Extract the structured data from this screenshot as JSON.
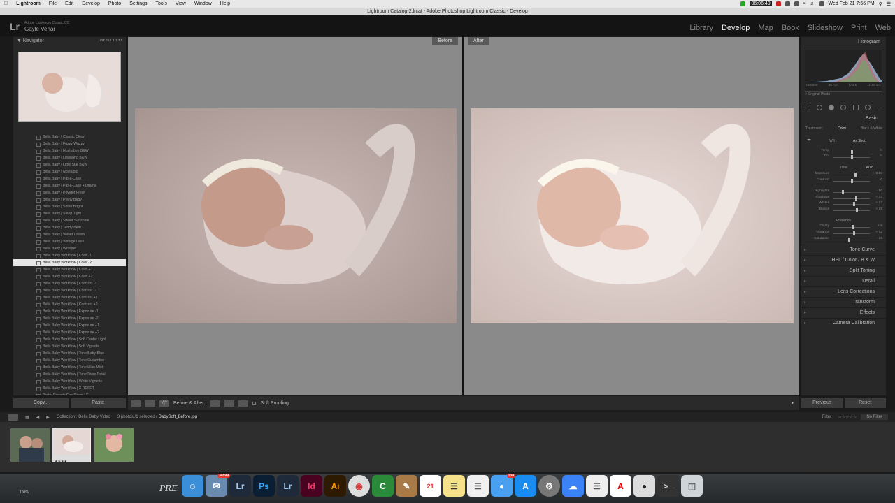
{
  "menubar": {
    "items": [
      "Lightroom",
      "File",
      "Edit",
      "Develop",
      "Photo",
      "Settings",
      "Tools",
      "View",
      "Window",
      "Help"
    ],
    "timer": "06:06:49",
    "datetime": "Wed Feb 21  7:56 PM"
  },
  "window_title": "Lightroom Catalog-2.lrcat - Adobe Photoshop Lightroom Classic - Develop",
  "lr_header": {
    "logo": "Lr",
    "edition": "Adobe Lightroom Classic CC",
    "user": "Gayle Vehar",
    "modules": [
      "Library",
      "Develop",
      "Map",
      "Book",
      "Slideshow",
      "Print",
      "Web"
    ],
    "active_module": "Develop"
  },
  "navigator": {
    "title": "Navigator",
    "zoom_options": "FIT   FILL   1:1   3:1"
  },
  "presets": [
    "Bella Baby | Classic Clean",
    "Bella Baby | Fuzzy Wuzzy",
    "Bella Baby | Hushabye B&W",
    "Bella Baby | Lovewing B&W",
    "Bella Baby | Little Star B&W",
    "Bella Baby | Nostalgic",
    "Bella Baby | Pat-a-Cake",
    "Bella Baby | Pat-a-Cake + Drama",
    "Bella Baby | Powder Fresh",
    "Bella Baby | Pretty Baby",
    "Bella Baby | Shine Bright",
    "Bella Baby | Sleep Tight",
    "Bella Baby | Sweet Sunshine",
    "Bella Baby | Teddy Bear",
    "Bella Baby | Velvet Dream",
    "Bella Baby | Vintage Lace",
    "Bella Baby | Whisper",
    "Bella Baby Workflow | Color -1",
    "Bella Baby Workflow | Color -2",
    "Bella Baby Workflow | Color +1",
    "Bella Baby Workflow | Color +2",
    "Bella Baby Workflow | Contrast -1",
    "Bella Baby Workflow | Contrast -2",
    "Bella Baby Workflow | Contrast +1",
    "Bella Baby Workflow | Contrast +2",
    "Bella Baby Workflow | Exposure -1",
    "Bella Baby Workflow | Exposure -2",
    "Bella Baby Workflow | Exposure +1",
    "Bella Baby Workflow | Exposure +2",
    "Bella Baby Workflow | Soft Center Light",
    "Bella Baby Workflow | Soft Vignette",
    "Bella Baby Workflow | Tone Baby Blue",
    "Bella Baby Workflow | Tone Cucumber",
    "Bella Baby Workflow | Tone Lilac Mist",
    "Bella Baby Workflow | Tone Rose Petal",
    "Bella Baby Workflow | White Vignette",
    "Bella Baby Workflow | X RESET",
    "Pretty Presets Eye Saver LE"
  ],
  "selected_preset_index": 18,
  "left_buttons": {
    "copy": "Copy...",
    "paste": "Paste"
  },
  "compare": {
    "before_label": "Before",
    "after_label": "After"
  },
  "toolbar": {
    "before_after": "Before & After :",
    "soft_proofing": "Soft Proofing",
    "yy": "Y|Y"
  },
  "histogram": {
    "title": "Histogram",
    "iso": "ISO 800",
    "focal": "35 mm",
    "aperture": "f / 2.5",
    "shutter": "1/160 sec",
    "original": "Original Photo"
  },
  "basic": {
    "title": "Basic",
    "treatment_label": "Treatment :",
    "color": "Color",
    "bw": "Black & White",
    "wb_label": "WB :",
    "wb_value": "As Shot",
    "tone_label": "Tone",
    "auto_label": "Auto",
    "presence_label": "Presence",
    "sliders": [
      {
        "label": "Temp",
        "value": "0",
        "pos": 0.5
      },
      {
        "label": "Tint",
        "value": "0",
        "pos": 0.5
      },
      {
        "label": "Exposure",
        "value": "+ 0.50",
        "pos": 0.6
      },
      {
        "label": "Contrast",
        "value": "0",
        "pos": 0.5
      },
      {
        "label": "Highlights",
        "value": "- 50",
        "pos": 0.25
      },
      {
        "label": "Shadows",
        "value": "+ 24",
        "pos": 0.62
      },
      {
        "label": "Whites",
        "value": "+ 12",
        "pos": 0.56
      },
      {
        "label": "Blacks",
        "value": "+ 28",
        "pos": 0.64
      },
      {
        "label": "Clarity",
        "value": "+ 5",
        "pos": 0.52
      },
      {
        "label": "Vibrance",
        "value": "+ 12",
        "pos": 0.56
      },
      {
        "label": "Saturation",
        "value": "- 15",
        "pos": 0.43
      }
    ]
  },
  "sections": [
    "Tone Curve",
    "HSL  /  Color  /  B & W",
    "Split Toning",
    "Detail",
    "Lens Corrections",
    "Transform",
    "Effects",
    "Camera Calibration"
  ],
  "right_buttons": {
    "previous": "Previous",
    "reset": "Reset"
  },
  "filmstrip_bar": {
    "collection": "Collection : Bella Baby Video",
    "count": "3 photos /1 selected /",
    "file": "BabySoft_Before.jpg",
    "filter_label": "Filter :",
    "filter_value": "No Filter"
  },
  "thumb_stars": "★★★★",
  "dock": {
    "text": "PRE",
    "zoom": "100%",
    "badge_mail": "34599",
    "badge_calendar": "21",
    "badge_msgs": "138"
  },
  "colors": {
    "accent": "#e6d9d6",
    "panel": "#282828",
    "compare_bg": "#8a8a8a"
  }
}
